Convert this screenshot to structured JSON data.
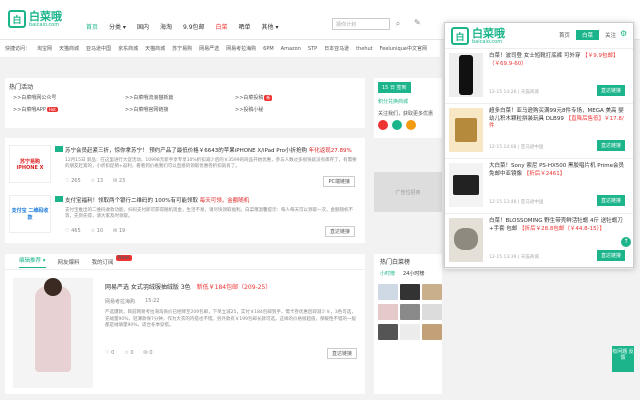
{
  "header": {
    "logo_text": "白菜哦",
    "logo_sub": "baicaio.com",
    "nav": [
      "首页",
      "分类 ▾",
      "国内",
      "海淘",
      "9.9包邮",
      "白菜",
      "晒单",
      "其他 ▾"
    ],
    "search_placeholder": "猜你计划"
  },
  "quick": {
    "label": "快捷访问：",
    "links": [
      "淘宝网",
      "天猫商城",
      "亚马逊中国",
      "京东商城",
      "天猫商城",
      "苏宁易购",
      "网易严选",
      "网易考拉海购",
      "6PM",
      "Amazon",
      "STP",
      "日本亚马逊",
      "thehut",
      "Feelunique中文官网"
    ]
  },
  "hot": {
    "title": "热门活动",
    "links": [
      ">>白菜哦网公众号",
      ">>白菜哦APP",
      ">>白菜哦流浪猫新篇",
      ">>白菜哦官网链接",
      ">>网页版",
      ">>投稿小秘",
      ">>白菜哦周报",
      ">>白菜投稿"
    ],
    "badges": [
      "Hot",
      "新"
    ]
  },
  "deals": [
    {
      "thumb": "苏宁易购 iPHONE X",
      "title": "苏宁会员赶紧三折，惊你拿苏宁！ 预约产品了最低价格￥6643的苹果iPHONE X/iPad Pro小折抢购",
      "price": "年化返现27.89%",
      "desc": "12月15日 新品：在这里进行大促活动，10998元新手享专享10%折扣减少后的￥3599的商品开始优惠，参与人数过多很快就没有库存了，有需要的朋友赶紧的，小折扣促销+返利，看看到价格我们可以直接的领取优惠卷折扣就有了。",
      "meta": [
        "265",
        "13",
        "23"
      ],
      "btn": "PC端链接"
    },
    {
      "thumb": "支付宝 二维码收款",
      "title": "支付宝福利！领取两个银行二维码的 100%有可能领取",
      "price": "每天可领，金额随机",
      "desc": "支付宝推出的二维码收款功能，扫码支付即可获得随机现金，生活不易，请尽快领取福利。白菜哦温馨提示：每人每天可以领取一次，金额随机不等，先到先得，请大家及时领取。",
      "meta": [
        "465",
        "10",
        "19"
      ],
      "btn": "直达链接"
    }
  ],
  "feed": {
    "tabs": [
      "编辑推荐 ▾",
      "网友爆料",
      "我的订阅"
    ],
    "new_badge": "New",
    "title": "网易严选 女式羽绒服抽绒版 3色",
    "price": "新低￥184包邮（209-25）",
    "source": "网易考拉海购",
    "time": "15:22",
    "desc": "严选爆款，目前网易考拉海淘商价已经降至209包邮，下单立减25，实付￥184包邮到手，需卡券优惠后即减少￥，3色可选，充绒量90%，轻薄款保7分钟，作为大衣的内搭也不错。另外款有￥199包邮长款可选，这样的价格很超值，保暖性不错的一般都是绒填量90%，适合冬季穿搭。",
    "meta": [
      "0",
      "0",
      "0"
    ],
    "btn": "直达链接"
  },
  "right": {
    "items": [
      "15 日 签到",
      "积分兑换商城",
      "关注我们，获取更多优惠",
      "扫码关注",
      "广告位招商"
    ],
    "rank_title": "热门白菜榜",
    "rank_tabs": [
      "小时榜",
      "24小时榜"
    ]
  },
  "side_btn": "有问题 反馈",
  "popup": {
    "logo_text": "白菜哦",
    "logo_sub": "baicaio.com",
    "tabs": [
      "首页",
      "白菜",
      "关注"
    ],
    "items": [
      {
        "title": "白菜！波司登 女士短靴打底裤 可外穿",
        "price": "【￥9.9包邮】（￥69.9-60）",
        "meta": "12-15 14:26 | 天猫商城",
        "btn": "直达链接"
      },
      {
        "title": "超多白菜！亚马逊购买满99元8件专场，MEGA 美高 婴幼儿积木颗粒拼装玩具 DLB99",
        "price": "【直降后售低】￥17.8/件",
        "meta": "12-15 14:08 | 亚马逊中国",
        "btn": "直达链接"
      },
      {
        "title": "大白菜！Sony 索尼 PS-HX500 黑胶唱片机 Prime会员免邮中亚镜像",
        "price": "【折后￥2461】",
        "meta": "12-15 13:48 | 亚马逊中国",
        "btn": "直达链接"
      },
      {
        "title": "白菜！BLOSSOMING 野生带壳鲜活牡蛎 4斤 送牡蛎刀+手套 包邮",
        "price": "【折后￥28.8包邮（￥44.8-15）】",
        "meta": "12-15 13:39 | 天猫商城",
        "btn": "直达链接"
      }
    ]
  }
}
